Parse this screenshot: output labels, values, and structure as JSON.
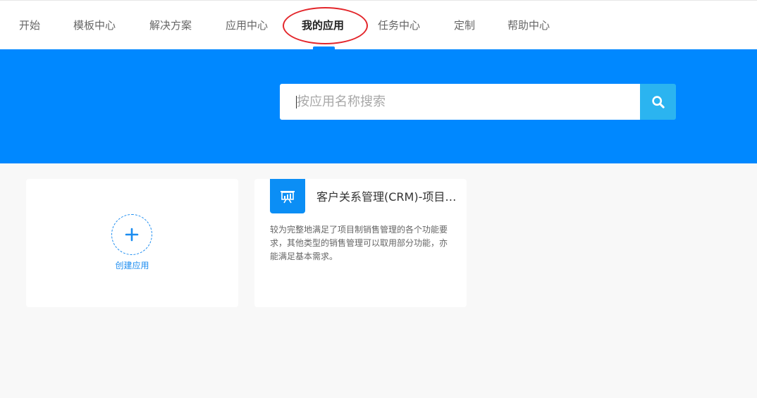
{
  "nav": {
    "items": [
      {
        "label": "开始"
      },
      {
        "label": "模板中心"
      },
      {
        "label": "解决方案"
      },
      {
        "label": "应用中心"
      },
      {
        "label": "我的应用",
        "active": true
      },
      {
        "label": "任务中心"
      },
      {
        "label": "定制"
      },
      {
        "label": "帮助中心"
      }
    ]
  },
  "search": {
    "placeholder": "按应用名称搜索",
    "value": "",
    "icon": "search-icon"
  },
  "create_card": {
    "label": "创建应用",
    "icon": "plus-icon"
  },
  "apps": [
    {
      "title": "客户关系管理(CRM)-项目制销售管理",
      "description": "较为完整地满足了项目制销售管理的各个功能要求，其他类型的销售管理可以取用部分功能，亦能满足基本需求。",
      "icon": "presentation-chart-icon"
    }
  ],
  "colors": {
    "primary": "#0088ff",
    "search_button": "#2bb4f0",
    "annotation": "#e3262b",
    "page_background": "#f8f8f8"
  }
}
